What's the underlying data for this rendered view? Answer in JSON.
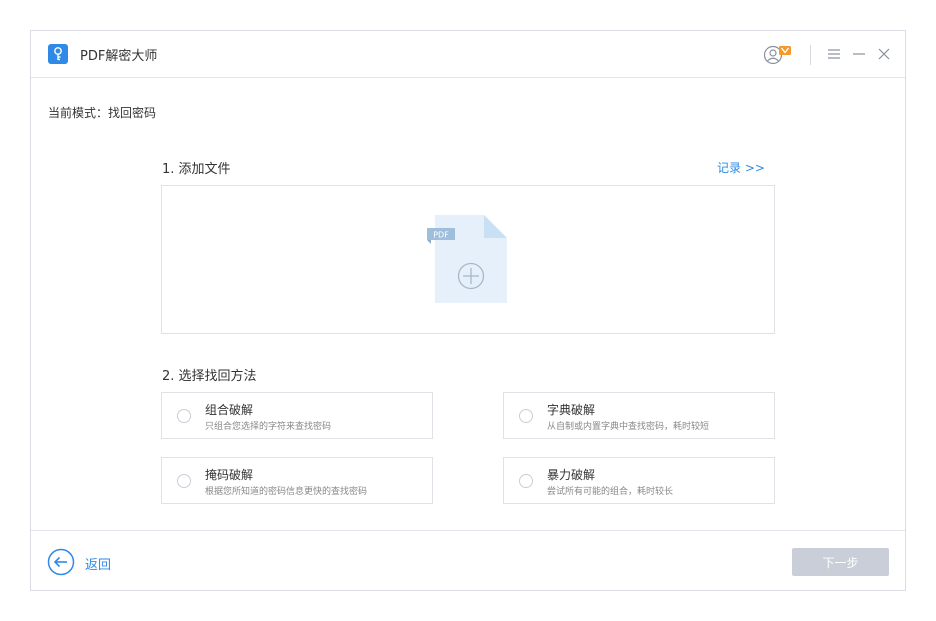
{
  "app": {
    "title": "PDF解密大师"
  },
  "mode": {
    "label": "当前模式：",
    "value": "找回密码"
  },
  "add_file": {
    "title": "1. 添加文件",
    "records_link": "记录 >>",
    "pdf_badge": "PDF"
  },
  "methods": {
    "title": "2. 选择找回方法",
    "options": [
      {
        "title": "组合破解",
        "desc": "只组合您选择的字符来查找密码"
      },
      {
        "title": "字典破解",
        "desc": "从自制或内置字典中查找密码，耗时较短"
      },
      {
        "title": "掩码破解",
        "desc": "根据您所知道的密码信息更快的查找密码"
      },
      {
        "title": "暴力破解",
        "desc": "尝试所有可能的组合，耗时较长"
      }
    ]
  },
  "footer": {
    "back_label": "返回",
    "next_label": "下一步"
  },
  "colors": {
    "accent": "#2e8ae6",
    "disabled_button": "#c9ced8",
    "pdf_fill": "#e5f0fa"
  }
}
